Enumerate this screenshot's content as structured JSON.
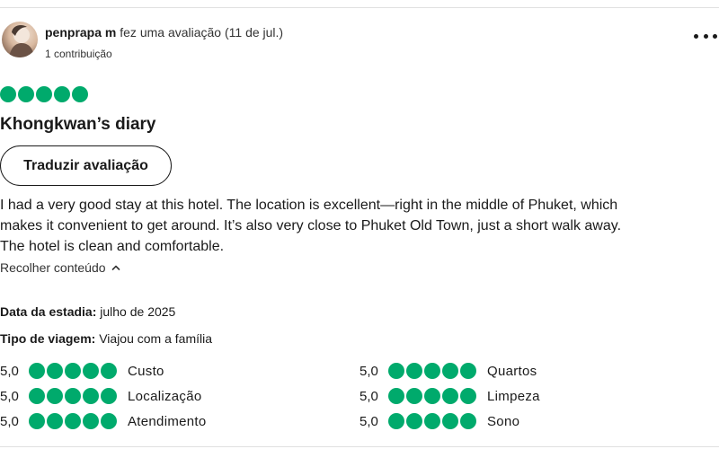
{
  "review": {
    "author": "penprapa m",
    "action": "fez uma avaliação (11 de jul.)",
    "contributions": "1 contribuição",
    "rating": 5,
    "title": "Khongkwan’s diary",
    "translate_label": "Traduzir avaliação",
    "body_lines": [
      "I had a very good stay at this hotel. The location is excellent—right in the middle of Phuket, which",
      "makes it convenient to get around. It’s also very close to Phuket Old Town, just a short walk away.",
      "The hotel is clean and comfortable."
    ],
    "collapse_label": "Recolher conteúdo",
    "stay_date_label": "Data da estadia:",
    "stay_date_value": "julho de 2025",
    "trip_type_label": "Tipo de viagem:",
    "trip_type_value": "Viajou com a família"
  },
  "sub_ratings": [
    {
      "score": "5,0",
      "bubbles": 5,
      "category": "Custo"
    },
    {
      "score": "5,0",
      "bubbles": 5,
      "category": "Localização"
    },
    {
      "score": "5,0",
      "bubbles": 5,
      "category": "Atendimento"
    },
    {
      "score": "5,0",
      "bubbles": 5,
      "category": "Quartos"
    },
    {
      "score": "5,0",
      "bubbles": 5,
      "category": "Limpeza"
    },
    {
      "score": "5,0",
      "bubbles": 5,
      "category": "Sono"
    }
  ],
  "colors": {
    "bubble": "#00aa6c",
    "text": "#1a1a1a"
  },
  "icons": {
    "more": "more-horizontal-icon",
    "collapse": "chevron-up-icon"
  }
}
